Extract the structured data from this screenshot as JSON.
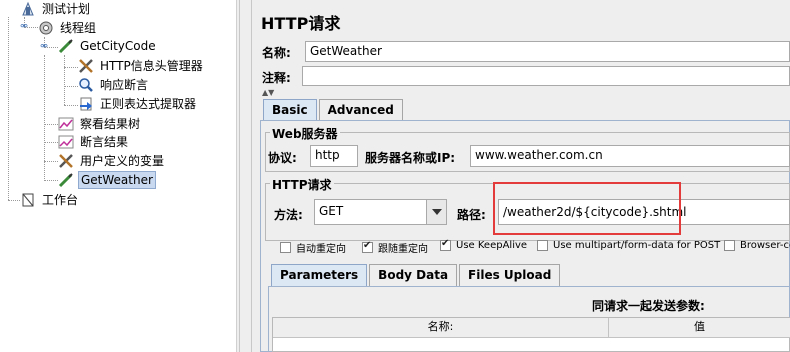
{
  "tree": {
    "items": [
      {
        "label": "测试计划",
        "icon": "test-plan-icon"
      },
      {
        "label": "线程组",
        "icon": "gear-icon"
      },
      {
        "label": "GetCityCode",
        "icon": "pipette-icon"
      },
      {
        "label": "HTTP信息头管理器",
        "icon": "tools-icon"
      },
      {
        "label": "响应断言",
        "icon": "magnifier-icon"
      },
      {
        "label": "正则表达式提取器",
        "icon": "arrow-doc-icon"
      },
      {
        "label": "察看结果树",
        "icon": "chart-icon"
      },
      {
        "label": "断言结果",
        "icon": "chart-icon"
      },
      {
        "label": "用户定义的变量",
        "icon": "tools-icon"
      },
      {
        "label": "GetWeather",
        "icon": "pipette-icon"
      },
      {
        "label": "工作台",
        "icon": "workbench-icon"
      }
    ]
  },
  "panel": {
    "title": "HTTP请求",
    "name_label": "名称:",
    "name_value": "GetWeather",
    "comment_label": "注释:",
    "comment_value": "",
    "tabs": [
      "Basic",
      "Advanced"
    ],
    "web_server": {
      "legend": "Web服务器",
      "protocol_label": "协议:",
      "protocol_value": "http",
      "server_label": "服务器名称或IP:",
      "server_value": "www.weather.com.cn"
    },
    "http_request": {
      "legend": "HTTP请求",
      "method_label": "方法:",
      "method_value": "GET",
      "path_label": "路径:",
      "path_value": "/weather2d/${citycode}.shtml"
    },
    "checkboxes": [
      {
        "label": "自动重定向",
        "checked": false
      },
      {
        "label": "跟随重定向",
        "checked": true
      },
      {
        "label": "Use KeepAlive",
        "checked": true
      },
      {
        "label": "Use multipart/form-data for POST",
        "checked": false
      },
      {
        "label": "Browser-co",
        "checked": false
      }
    ],
    "sub_tabs": [
      "Parameters",
      "Body Data",
      "Files Upload"
    ],
    "params_caption": "同请求一起发送参数:",
    "table_headers": [
      "名称:",
      "值"
    ]
  },
  "colors": {
    "highlight": "#e33b3b",
    "selection": "#c9d9ef"
  }
}
